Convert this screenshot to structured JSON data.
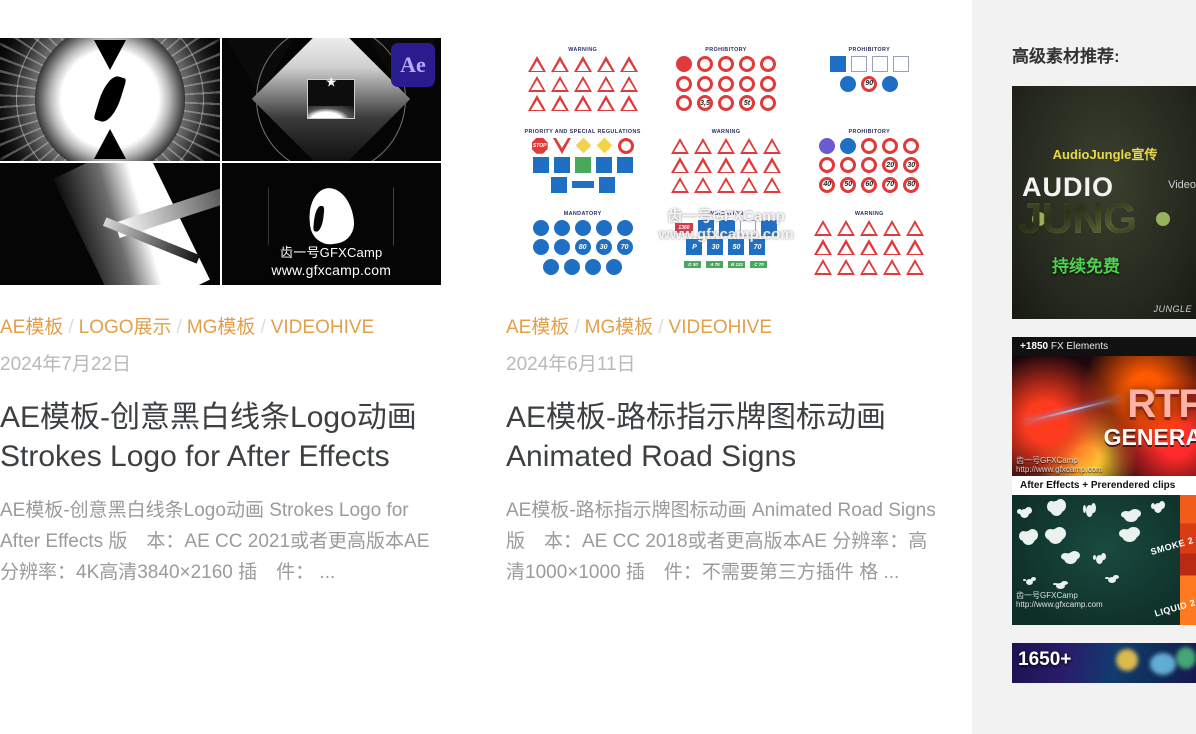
{
  "site": {
    "watermark_name": "齿一号GFXCamp",
    "watermark_url": "www.gfxcamp.com"
  },
  "posts": [
    {
      "thumbnail_alt": "AE模板-创意黑白线条Logo动画 Strokes Logo for After Effects 预览图",
      "thumbnail_badge": "Ae",
      "categories": [
        "AE模板",
        "LOGO展示",
        "MG模板",
        "VIDEOHIVE"
      ],
      "separator": "/",
      "date": "2024年7月22日",
      "title": "AE模板-创意黑白线条Logo动画 Strokes Logo for After Effects",
      "excerpt": "AE模板-创意黑白线条Logo动画 Strokes Logo for After Effects 版　本：AE CC 2021或者更高版本AE 分辨率：4K高清3840×2160 插　件： ..."
    },
    {
      "thumbnail_alt": "AE模板-路标指示牌图标动画 Animated Road Signs 预览图",
      "categories": [
        "AE模板",
        "MG模板",
        "VIDEOHIVE"
      ],
      "separator": "/",
      "date": "2024年6月11日",
      "title": "AE模板-路标指示牌图标动画 Animated Road Signs",
      "excerpt": "AE模板-路标指示牌图标动画 Animated Road Signs 版　本：AE CC 2018或者更高版本AE 分辨率：高清1000×1000 插　件：不需要第三方插件 格 ...",
      "sign_groups": [
        {
          "title": "WARNING"
        },
        {
          "title": "PROHIBITORY"
        },
        {
          "title": "PROHIBITORY"
        },
        {
          "title": "PRIORITY AND SPECIAL REGULATIONS"
        },
        {
          "title": "WARNING"
        },
        {
          "title": "PROHIBITORY"
        },
        {
          "title": "MANDATORY"
        },
        {
          "title": "INDICATION"
        },
        {
          "title": "WARNING"
        }
      ],
      "sign_labels": [
        "20",
        "30",
        "90",
        "40",
        "50",
        "60",
        "70",
        "80",
        "30",
        "50",
        "70",
        "STOP",
        "P",
        "1360",
        "D 30",
        "A 75",
        "B 121",
        "C 70",
        "5t",
        "3,5"
      ]
    }
  ],
  "sidebar": {
    "title": "高级素材推荐:",
    "ads": [
      {
        "name": "audiojungle-ad",
        "headline": "AudioJungle宣传",
        "brand_top": "AUDIO",
        "brand_side": "Video",
        "brand_main": "JUNG",
        "subline": "持续免费",
        "mark": "JUNGLE"
      },
      {
        "name": "rtfx-generator-ad",
        "top_count": "+1850",
        "top_label": "FX Elements",
        "title_main": "RTF",
        "title_sub": "GENERA",
        "footer": "After Effects + Prerendered clips",
        "tag_smoke": "SMOKE 2",
        "tag_liquid": "LIQUID 2",
        "watermark_name": "齿一号GFXCamp",
        "watermark_url": "http://www.gfxcamp.com"
      },
      {
        "name": "elements-pack-ad",
        "count": "1650+"
      }
    ]
  },
  "colors": {
    "category_link": "#E3A04B",
    "date_text": "#b9b9b9",
    "title_text": "#3c4043",
    "excerpt_text": "#9b9b9b",
    "sidebar_bg": "#f2f2f2",
    "page_bg": "#ffffff"
  }
}
